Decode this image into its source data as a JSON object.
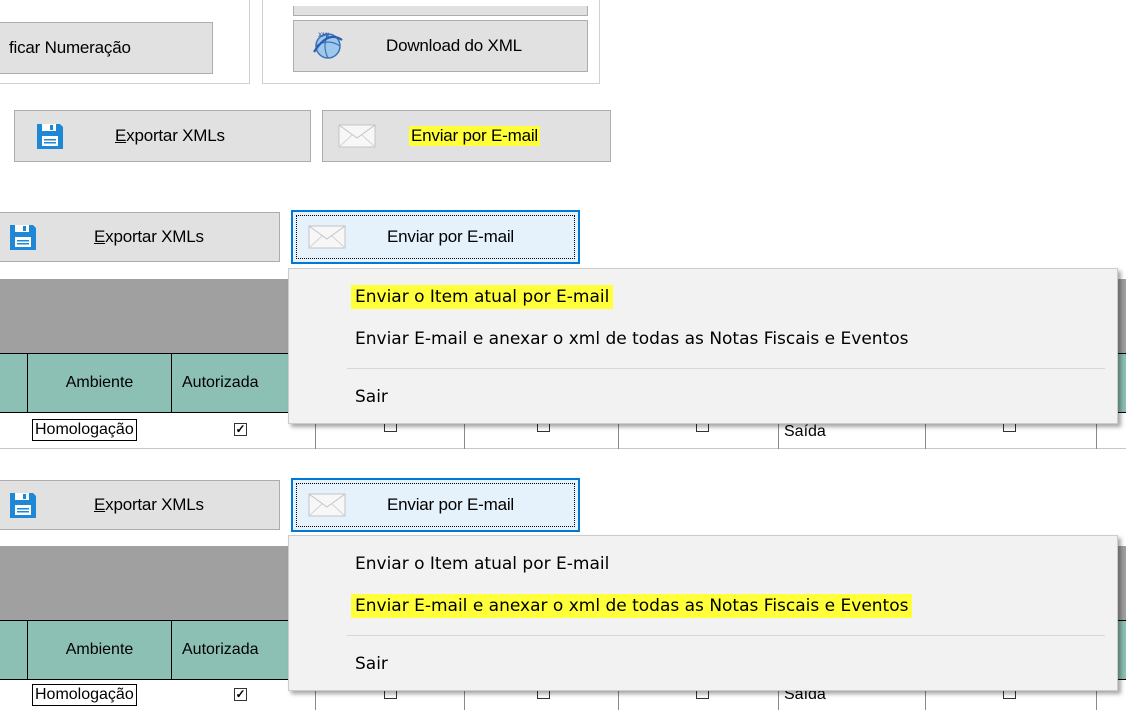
{
  "section1": {
    "verify_numbering_label": "ficar Numeração",
    "download_xml_label": "Download do XML",
    "export_xmls": {
      "underline": "E",
      "rest": "xportar XMLs"
    },
    "send_email_label": "Enviar por E-mail"
  },
  "section2": {
    "export_xmls": {
      "underline": "E",
      "rest": "xportar XMLs"
    },
    "send_email_label": "Enviar por E-mail",
    "table": {
      "col_ambiente": "Ambiente",
      "col_autorizada": "Autorizada",
      "row_ambiente": "Homologação",
      "row_tipo": "Saída"
    },
    "menu": {
      "item_current": "Enviar o Item atual por E-mail",
      "item_all": "Enviar E-mail e anexar o xml de todas as Notas Fiscais e Eventos",
      "item_exit": "Sair"
    }
  },
  "section3": {
    "export_xmls": {
      "underline": "E",
      "rest": "xportar XMLs"
    },
    "send_email_label": "Enviar por E-mail",
    "table": {
      "col_ambiente": "Ambiente",
      "col_autorizada": "Autorizada",
      "row_ambiente": "Homologação",
      "row_tipo": "Saída"
    },
    "menu": {
      "item_current": "Enviar o Item atual por E-mail",
      "item_all": "Enviar E-mail e anexar o xml de todas as Notas Fiscais e Eventos",
      "item_exit": "Sair"
    }
  },
  "icons": {
    "save": "floppy-disk-icon",
    "email": "envelope-icon",
    "download": "globe-xml-icon"
  },
  "colors": {
    "highlight": "#ffff3a",
    "table_header": "#8cc0b4",
    "focus_border": "#0078d7",
    "save_icon": "#1e88d6"
  }
}
